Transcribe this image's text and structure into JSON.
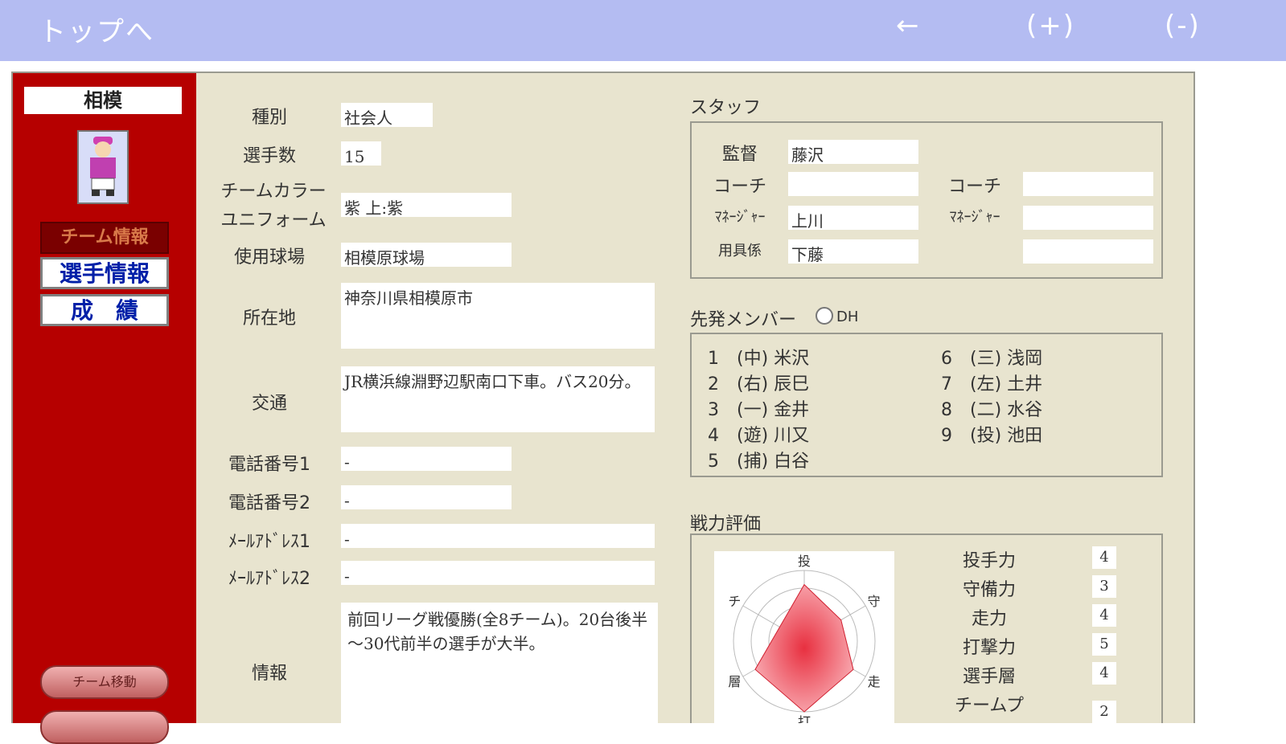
{
  "header": {
    "top_link": "トップへ",
    "back": "←",
    "zoom_in": "(+)",
    "zoom_out": "(-)"
  },
  "sidebar": {
    "team_name": "相模",
    "nav": [
      "チーム情報",
      "選手情報",
      "成　績"
    ],
    "move_button": "チーム移動"
  },
  "info": {
    "category_label": "種別",
    "category": "社会人",
    "players_label": "選手数",
    "players": "15",
    "color_label": "チームカラー",
    "color": "紫",
    "uniform_label": "ユニフォーム",
    "uniform": "上:紫",
    "stadium_label": "使用球場",
    "stadium": "相模原球場",
    "address_label": "所在地",
    "address": "神奈川県相模原市",
    "access_label": "交通",
    "access": "JR横浜線淵野辺駅南口下車。バス20分。",
    "phone1_label": "電話番号1",
    "phone1": "-",
    "phone2_label": "電話番号2",
    "phone2": "-",
    "mail1_label": "ﾒｰﾙｱﾄﾞﾚｽ1",
    "mail1": "-",
    "mail2_label": "ﾒｰﾙｱﾄﾞﾚｽ2",
    "mail2": "-",
    "notes_label": "情報",
    "notes": "前回リーグ戦優勝(全8チーム)。20台後半～30代前半の選手が大半。"
  },
  "staff": {
    "title": "スタッフ",
    "manager_label": "監督",
    "manager": "藤沢",
    "coach_label": "コーチ",
    "coach1": "",
    "coach2": "",
    "mgr_label": "ﾏﾈｰｼﾞｬｰ",
    "mgr1": "上川",
    "mgr2": "",
    "equip_label": "用具係",
    "equip1": "下藤",
    "equip2": ""
  },
  "lineup": {
    "title": "先発メンバー",
    "dh_label": "DH",
    "members": [
      "1　(中) 米沢",
      "2　(右) 辰巳",
      "3　(一) 金井",
      "4　(遊) 川又",
      "5　(捕) 白谷",
      "6　(三) 浅岡",
      "7　(左) 土井",
      "8　(二) 水谷",
      "9　(投) 池田"
    ]
  },
  "strength": {
    "title": "戦力評価",
    "axes": [
      "投",
      "守",
      "走",
      "打",
      "層",
      "チ"
    ],
    "values": [
      4,
      3,
      4,
      5,
      4,
      2
    ],
    "labels": [
      "投手力",
      "守備力",
      "走力",
      "打撃力",
      "選手層",
      "チームプ"
    ]
  }
}
